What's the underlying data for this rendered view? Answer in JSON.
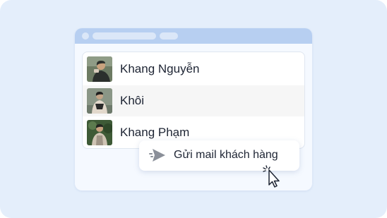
{
  "contacts": [
    {
      "name": "Khang Nguyễn",
      "avatar_colors": [
        "#5b6a4f",
        "#c9a27e",
        "#2b2f2c"
      ]
    },
    {
      "name": "Khôi",
      "avatar_colors": [
        "#7c8a78",
        "#2a2a2a",
        "#d9cfc2"
      ]
    },
    {
      "name": "Khang Phạm",
      "avatar_colors": [
        "#3e5a36",
        "#cfc4b4",
        "#22251f"
      ]
    }
  ],
  "tooltip": {
    "label": "Gửi mail khách hàng",
    "icon": "send-icon"
  },
  "colors": {
    "background": "#e4eefb",
    "titlebar": "#b7cff1",
    "highlight_row": "#f6f6f6",
    "icon_gray": "#8a8f99"
  }
}
